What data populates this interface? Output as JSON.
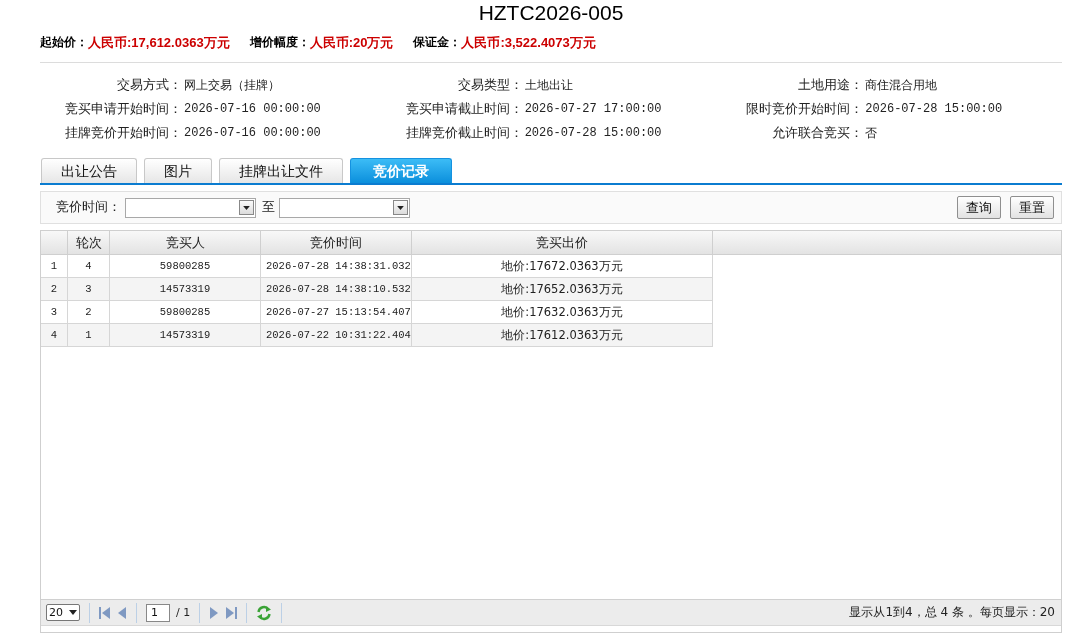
{
  "title": "HZTC2026-005",
  "price_summary": [
    {
      "label": "起始价：",
      "value": "人民币:17,612.0363万元"
    },
    {
      "label": "增价幅度：",
      "value": "人民币:20万元"
    },
    {
      "label": "保证金：",
      "value": "人民币:3,522.4073万元"
    }
  ],
  "details": [
    {
      "label": "交易方式：",
      "value": "网上交易（挂牌）"
    },
    {
      "label": "交易类型：",
      "value": "土地出让"
    },
    {
      "label": "土地用途：",
      "value": "商住混合用地"
    },
    {
      "label": "竞买申请开始时间：",
      "value": "2026-07-16 00:00:00"
    },
    {
      "label": "竞买申请截止时间：",
      "value": "2026-07-27 17:00:00"
    },
    {
      "label": "限时竞价开始时间：",
      "value": "2026-07-28 15:00:00"
    },
    {
      "label": "挂牌竞价开始时间：",
      "value": "2026-07-16 00:00:00"
    },
    {
      "label": "挂牌竞价截止时间：",
      "value": "2026-07-28 15:00:00"
    },
    {
      "label": "允许联合竞买：",
      "value": "否"
    }
  ],
  "tabs": [
    {
      "label": "出让公告",
      "selected": false
    },
    {
      "label": "图片",
      "selected": false
    },
    {
      "label": "挂牌出让文件",
      "selected": false
    },
    {
      "label": "竞价记录",
      "selected": true
    }
  ],
  "filter": {
    "label": "竞价时间：",
    "separator": "至",
    "buttons": [
      "查询",
      "重置"
    ]
  },
  "table": {
    "columns": [
      "轮次",
      "竞买人",
      "竞价时间",
      "竞买出价"
    ],
    "rows": [
      {
        "index": "1",
        "cells": [
          "4",
          "59800285",
          "2026-07-28 14:38:31.032",
          "地价:17672.0363万元"
        ]
      },
      {
        "index": "2",
        "cells": [
          "3",
          "14573319",
          "2026-07-28 14:38:10.532",
          "地价:17652.0363万元"
        ]
      },
      {
        "index": "3",
        "cells": [
          "2",
          "59800285",
          "2026-07-27 15:13:54.407",
          "地价:17632.0363万元"
        ]
      },
      {
        "index": "4",
        "cells": [
          "1",
          "14573319",
          "2026-07-22 10:31:22.404",
          "地价:17612.0363万元"
        ]
      }
    ]
  },
  "pager": {
    "page_size": "20",
    "page": "1",
    "page_count": "/ 1",
    "summary": "显示从1到4，总 4 条 。每页显示：20"
  }
}
